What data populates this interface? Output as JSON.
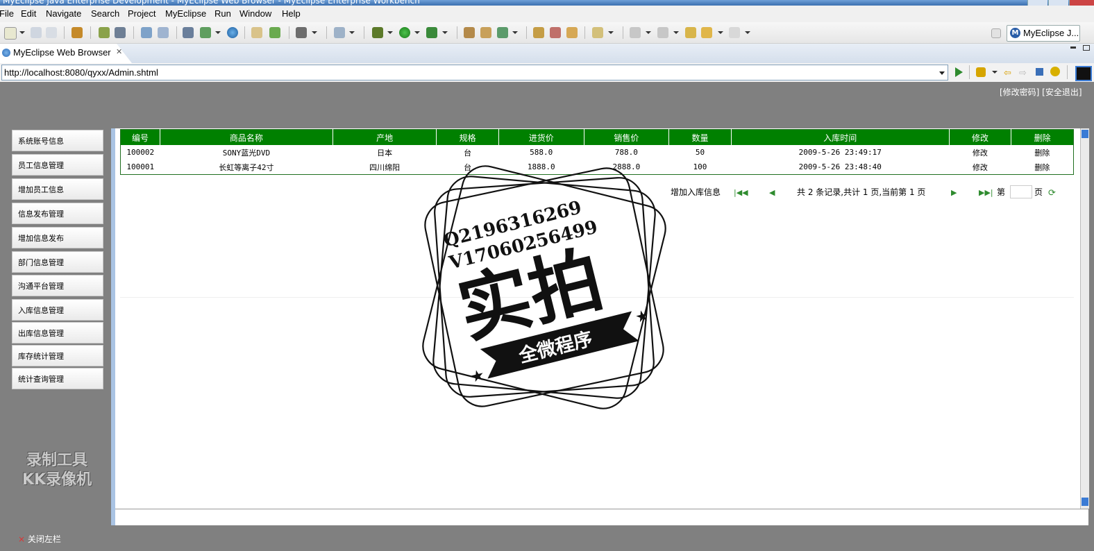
{
  "window": {
    "title": "MyEclipse Java Enterprise Development - MyEclipse Web Browser - MyEclipse Enterprise Workbench"
  },
  "menu": [
    "File",
    "Edit",
    "Navigate",
    "Search",
    "Project",
    "MyEclipse",
    "Run",
    "Window",
    "Help"
  ],
  "toolbar": {
    "perspective_label": "MyEclipse J..."
  },
  "editor_tab": {
    "label": "MyEclipse Web Browser"
  },
  "browser": {
    "url": "http://localhost:8080/qyxx/Admin.shtml"
  },
  "page": {
    "top_links": "[修改密码] [安全退出]",
    "sidebar": [
      "系统账号信息",
      "员工信息管理",
      "增加员工信息",
      "信息发布管理",
      "增加信息发布",
      "部门信息管理",
      "沟通平台管理",
      "入库信息管理",
      "出库信息管理",
      "库存统计管理",
      "统计查询管理"
    ],
    "table": {
      "headers": [
        "编号",
        "商品名称",
        "产地",
        "规格",
        "进货价",
        "销售价",
        "数量",
        "入库时间",
        "修改",
        "删除"
      ],
      "rows": [
        [
          "100002",
          "SONY蓝光DVD",
          "日本",
          "台",
          "588.0",
          "788.0",
          "50",
          "2009-5-26 23:49:17",
          "修改",
          "删除"
        ],
        [
          "100001",
          "长虹等离子42寸",
          "四川绵阳",
          "台",
          "1888.0",
          "2888.0",
          "100",
          "2009-5-26 23:48:40",
          "修改",
          "删除"
        ]
      ]
    },
    "pager": {
      "add_link": "增加入库信息",
      "summary": "共 2 条记录,共计 1 页,当前第 1 页",
      "goto_prefix": "第",
      "goto_suffix": "页"
    },
    "close_sidebar": "关闭左栏"
  },
  "watermarks": {
    "stamp_line1": "Q2196316269",
    "stamp_line2": "V17060256499",
    "stamp_big": "实拍",
    "stamp_banner": "全微程序",
    "kk_line1": "录制工具",
    "kk_line2": "KK录像机"
  }
}
